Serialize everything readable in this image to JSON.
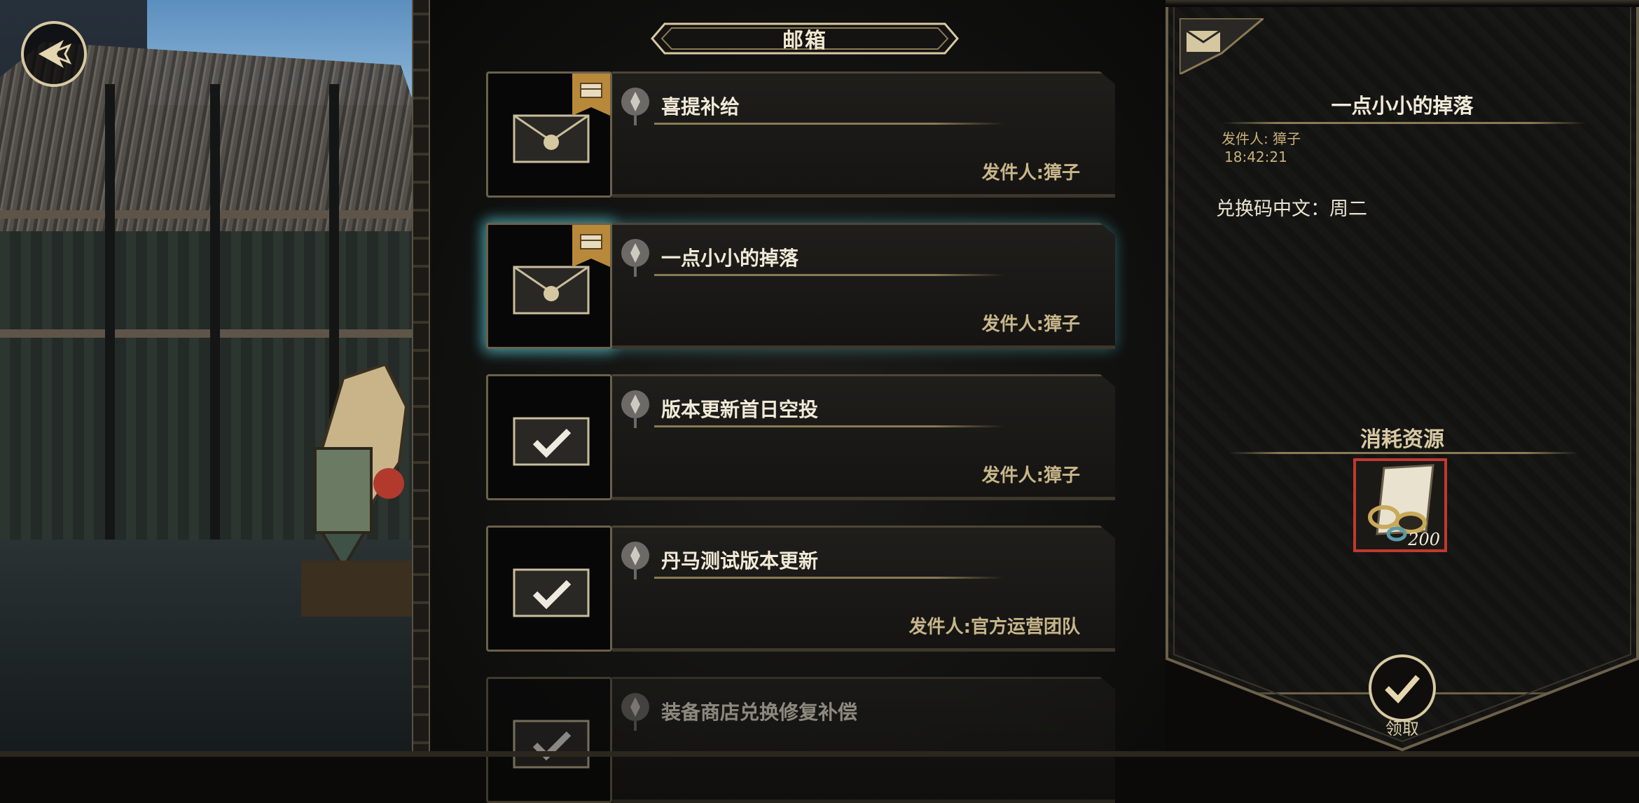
{
  "header": {
    "title": "邮箱"
  },
  "mails": [
    {
      "subject": "喜提补给",
      "sender": "发件人:獐子",
      "state": "unread"
    },
    {
      "subject": "一点小小的掉落",
      "sender": "发件人:獐子",
      "state": "selected"
    },
    {
      "subject": "版本更新首日空投",
      "sender": "发件人:獐子",
      "state": "claimed"
    },
    {
      "subject": "丹马测试版本更新",
      "sender": "发件人:官方运营团队",
      "state": "claimed"
    },
    {
      "subject": "装备商店兑换修复补偿",
      "sender": "",
      "state": "claimed"
    }
  ],
  "detail": {
    "title": "一点小小的掉落",
    "sender": "发件人: 獐子",
    "time": "18:42:21",
    "body": "兑换码中文：周二",
    "resources_label": "消耗资源",
    "item": {
      "quantity": "200",
      "icon": "coins-scroll-icon"
    },
    "claim_label": "领取"
  },
  "colors": {
    "gold": "#d8c9a2",
    "selected_glow": "#5abec8",
    "item_border": "#c0392f"
  }
}
